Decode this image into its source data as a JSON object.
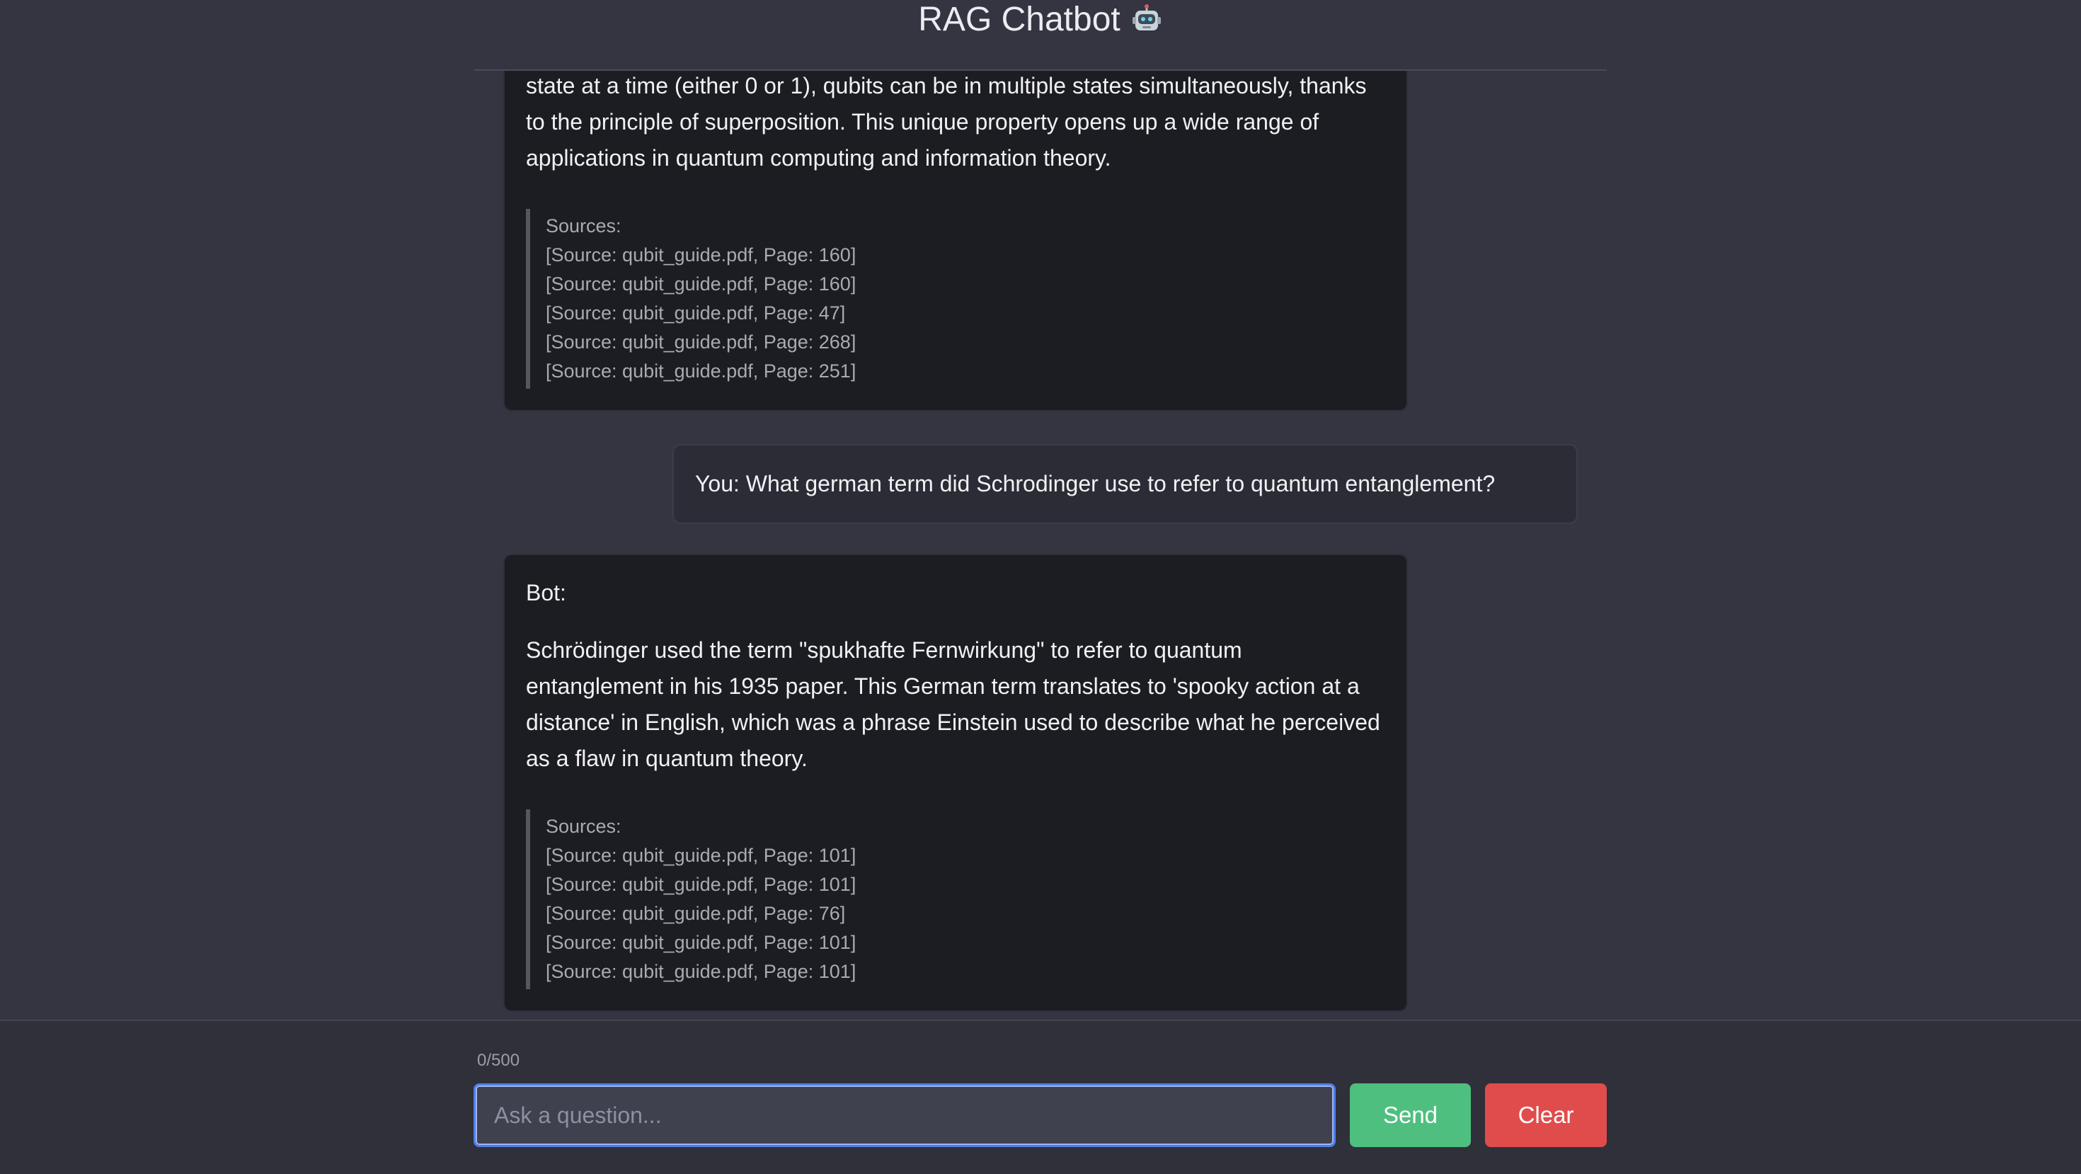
{
  "header": {
    "title": "RAG Chatbot",
    "icon": "robot-icon"
  },
  "messages": {
    "bot1": {
      "text_lines": "state at a time (either 0 or 1), qubits can be in multiple states simultaneously, thanks to the principle of superposition. This unique property opens up a wide range of applications in quantum computing and information theory.",
      "sources_label": "Sources:",
      "sources": [
        "[Source: qubit_guide.pdf, Page: 160]",
        "[Source: qubit_guide.pdf, Page: 160]",
        "[Source: qubit_guide.pdf, Page: 47]",
        "[Source: qubit_guide.pdf, Page: 268]",
        "[Source: qubit_guide.pdf, Page: 251]"
      ]
    },
    "user1": {
      "text": "You: What german term did Schrodinger use to refer to quantum entanglement?"
    },
    "bot2": {
      "label": "Bot:",
      "text": "Schrödinger used the term \"spukhafte Fernwirkung\" to refer to quantum entanglement in his 1935 paper. This German term translates to 'spooky action at a distance' in English, which was a phrase Einstein used to describe what he perceived as a flaw in quantum theory.",
      "sources_label": "Sources:",
      "sources": [
        "[Source: qubit_guide.pdf, Page: 101]",
        "[Source: qubit_guide.pdf, Page: 101]",
        "[Source: qubit_guide.pdf, Page: 76]",
        "[Source: qubit_guide.pdf, Page: 101]",
        "[Source: qubit_guide.pdf, Page: 101]"
      ]
    }
  },
  "footer": {
    "char_counter": "0/500",
    "input_value": "",
    "input_placeholder": "Ask a question...",
    "send_label": "Send",
    "clear_label": "Clear"
  },
  "colors": {
    "background": "#343541",
    "send": "#4fbf7f",
    "clear": "#e04c4c",
    "input_focus": "#4f7ee8"
  }
}
